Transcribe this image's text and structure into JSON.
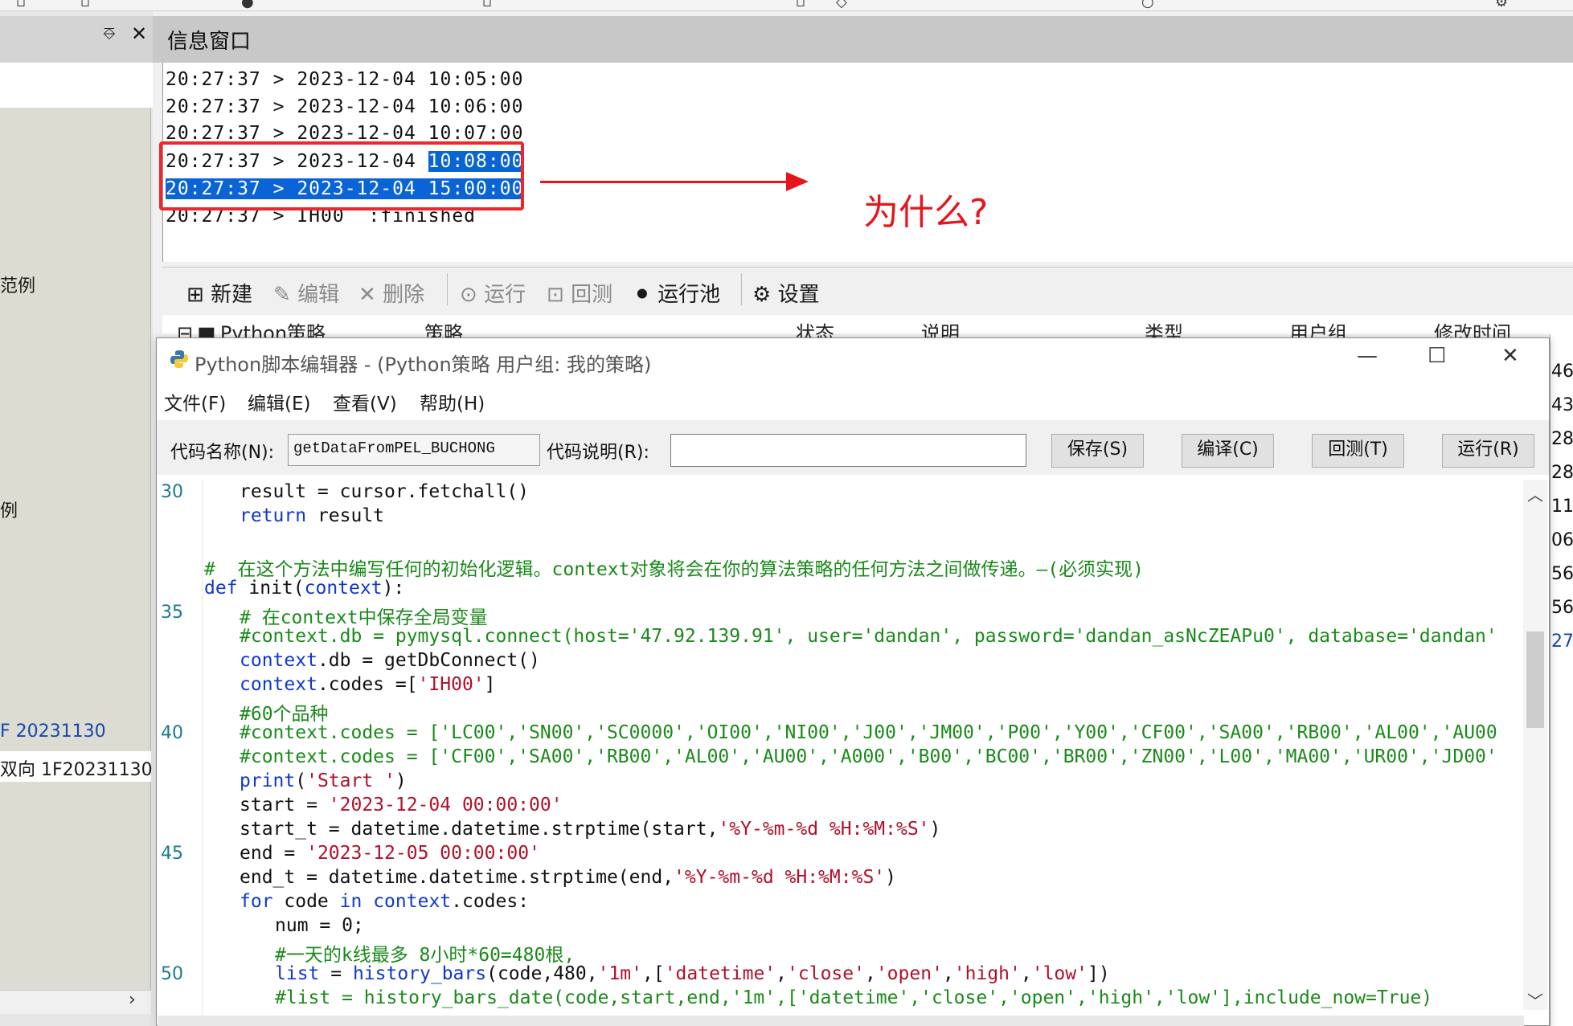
{
  "left_panel": {
    "pin_glyph": "⎑",
    "close_glyph": "✕",
    "items": [
      {
        "label": "范例",
        "blue": false
      },
      {
        "label": "例",
        "blue": false
      },
      {
        "label": "F 20231130",
        "blue": true
      },
      {
        "label": "双向 1F20231130",
        "blue": false
      }
    ],
    "scroll_arrow": "›"
  },
  "info_window": {
    "title": "信息窗口",
    "lines": [
      {
        "pre": "20:27:37 > 2023-12-04 10:05:00",
        "hl": ""
      },
      {
        "pre": "20:27:37 > 2023-12-04 10:06:00",
        "hl": ""
      },
      {
        "pre": "20:27:37 > 2023-12-04 10:07:00",
        "hl": ""
      },
      {
        "pre": "20:27:37 > 2023-12-04 ",
        "hl": "10:08:00"
      },
      {
        "pre": "",
        "hl": "20:27:37 > 2023-12-04 15:00:00"
      },
      {
        "pre": "20:27:37 > IH00  :finished",
        "hl": ""
      }
    ],
    "annotation": "为什么?",
    "colors": {
      "highlight": "#0a64d6",
      "annotation": "#e8141c"
    }
  },
  "strategy_toolbar": {
    "new": "新建",
    "edit": "编辑",
    "delete": "删除",
    "run": "运行",
    "backtest": "回测",
    "run_pool": "运行池",
    "settings": "设置",
    "tree_root": "Python策略",
    "columns": [
      "策略",
      "状态",
      "说明",
      "类型",
      "用户组",
      "修改时间"
    ]
  },
  "right_column": {
    "values": [
      "46",
      "43",
      "28",
      "28",
      "11",
      "06",
      "56",
      "56",
      "27"
    ]
  },
  "editor": {
    "title": "Python脚本编辑器 - (Python策略 用户组: 我的策略)",
    "window_buttons": {
      "minimize": "—",
      "maximize": "☐",
      "close": "✕"
    },
    "menu": [
      "文件(F)",
      "编辑(E)",
      "查看(V)",
      "帮助(H)"
    ],
    "code_name_label": "代码名称(N):",
    "code_name_value": "getDataFromPEL_BUCHONG",
    "code_desc_label": "代码说明(R):",
    "code_desc_value": "",
    "buttons": {
      "save": "保存(S)",
      "compile": "编译(C)",
      "backtest": "回测(T)",
      "run": "运行(R)"
    },
    "line_numbers": [
      "30",
      "35",
      "40",
      "45",
      "50"
    ],
    "code_lines": [
      {
        "indent": 1,
        "parts": [
          {
            "t": "result = cursor.fetchall()",
            "c": ""
          }
        ]
      },
      {
        "indent": 1,
        "parts": [
          {
            "t": "return",
            "c": "kw"
          },
          {
            "t": " result",
            "c": ""
          }
        ]
      },
      {
        "indent": 0,
        "parts": []
      },
      {
        "indent": 0,
        "parts": [
          {
            "t": "#  在这个方法中编写任何的初始化逻辑。context对象将会在你的算法策略的任何方法之间做传递。—(必须实现)",
            "c": "cm"
          }
        ]
      },
      {
        "indent": 0,
        "parts": [
          {
            "t": "def",
            "c": "kw"
          },
          {
            "t": " init(",
            "c": ""
          },
          {
            "t": "context",
            "c": "kw"
          },
          {
            "t": "):",
            "c": ""
          }
        ]
      },
      {
        "indent": 1,
        "parts": [
          {
            "t": "# 在context中保存全局变量",
            "c": "cm"
          }
        ]
      },
      {
        "indent": 1,
        "parts": [
          {
            "t": "#context.db = pymysql.connect(host='47.92.139.91', user='dandan', password='dandan_asNcZEAPu0', database='dandan'",
            "c": "cm"
          }
        ]
      },
      {
        "indent": 1,
        "parts": [
          {
            "t": "context",
            "c": "kw"
          },
          {
            "t": ".db = getDbConnect()",
            "c": ""
          }
        ]
      },
      {
        "indent": 1,
        "parts": [
          {
            "t": "context",
            "c": "kw"
          },
          {
            "t": ".codes =[",
            "c": ""
          },
          {
            "t": "'IH00'",
            "c": "st"
          },
          {
            "t": "]",
            "c": ""
          }
        ]
      },
      {
        "indent": 1,
        "parts": [
          {
            "t": "#60个品种",
            "c": "cm"
          }
        ]
      },
      {
        "indent": 1,
        "parts": [
          {
            "t": "#context.codes = ['LC00','SN00','SC0000','OI00','NI00','J00','JM00','P00','Y00','CF00','SA00','RB00','AL00','AU00",
            "c": "cm"
          }
        ]
      },
      {
        "indent": 1,
        "parts": [
          {
            "t": "#context.codes = ['CF00','SA00','RB00','AL00','AU00','A000','B00','BC00','BR00','ZN00','L00','MA00','UR00','JD00'",
            "c": "cm"
          }
        ]
      },
      {
        "indent": 1,
        "parts": [
          {
            "t": "print",
            "c": "kw"
          },
          {
            "t": "(",
            "c": ""
          },
          {
            "t": "'Start '",
            "c": "st"
          },
          {
            "t": ")",
            "c": ""
          }
        ]
      },
      {
        "indent": 1,
        "parts": [
          {
            "t": "start = ",
            "c": ""
          },
          {
            "t": "'2023-12-04 00:00:00'",
            "c": "st"
          }
        ]
      },
      {
        "indent": 1,
        "parts": [
          {
            "t": "start_t = datetime.datetime.strptime(start,",
            "c": ""
          },
          {
            "t": "'%Y-%m-%d %H:%M:%S'",
            "c": "st"
          },
          {
            "t": ")",
            "c": ""
          }
        ]
      },
      {
        "indent": 1,
        "parts": [
          {
            "t": "end = ",
            "c": ""
          },
          {
            "t": "'2023-12-05 00:00:00'",
            "c": "st"
          }
        ]
      },
      {
        "indent": 1,
        "parts": [
          {
            "t": "end_t = datetime.datetime.strptime(end,",
            "c": ""
          },
          {
            "t": "'%Y-%m-%d %H:%M:%S'",
            "c": "st"
          },
          {
            "t": ")",
            "c": ""
          }
        ]
      },
      {
        "indent": 1,
        "parts": [
          {
            "t": "for",
            "c": "kw"
          },
          {
            "t": " code ",
            "c": ""
          },
          {
            "t": "in",
            "c": "kw"
          },
          {
            "t": " ",
            "c": ""
          },
          {
            "t": "context",
            "c": "kw"
          },
          {
            "t": ".codes:",
            "c": ""
          }
        ]
      },
      {
        "indent": 2,
        "parts": [
          {
            "t": "num = 0;",
            "c": ""
          }
        ]
      },
      {
        "indent": 2,
        "parts": [
          {
            "t": "#一天的k线最多 8小时*60=480根,",
            "c": "cm"
          }
        ]
      },
      {
        "indent": 2,
        "parts": [
          {
            "t": "list",
            "c": "kw"
          },
          {
            "t": " = ",
            "c": ""
          },
          {
            "t": "history_bars",
            "c": "kw"
          },
          {
            "t": "(code,480,",
            "c": ""
          },
          {
            "t": "'1m'",
            "c": "st"
          },
          {
            "t": ",[",
            "c": ""
          },
          {
            "t": "'datetime'",
            "c": "st"
          },
          {
            "t": ",",
            "c": ""
          },
          {
            "t": "'close'",
            "c": "st"
          },
          {
            "t": ",",
            "c": ""
          },
          {
            "t": "'open'",
            "c": "st"
          },
          {
            "t": ",",
            "c": ""
          },
          {
            "t": "'high'",
            "c": "st"
          },
          {
            "t": ",",
            "c": ""
          },
          {
            "t": "'low'",
            "c": "st"
          },
          {
            "t": "])",
            "c": ""
          }
        ]
      },
      {
        "indent": 2,
        "parts": [
          {
            "t": "#list = history_bars_date(code,start,end,'1m',['datetime','close','open','high','low'],include_now=True)",
            "c": "cm"
          }
        ]
      }
    ]
  }
}
